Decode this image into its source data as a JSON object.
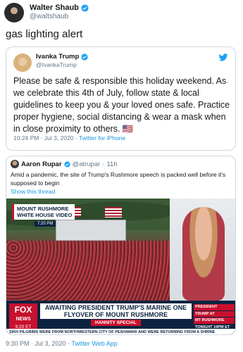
{
  "author": {
    "display_name": "Walter Shaub",
    "handle": "@waltshaub"
  },
  "tweet": {
    "text": "gas lighting alert",
    "timestamp": "9:30 PM · Jul 3, 2020",
    "source": "Twitter Web App"
  },
  "quoted_tweet": {
    "display_name": "Ivanka Trump",
    "handle": "@IvankaTrump",
    "text": "Please be safe & responsible this holiday weekend. As we celebrate this 4th of July, follow state & local guidelines to keep you & your loved ones safe. Practice proper hygiene, social distancing & wear a mask when in close proximity to others. 🇺🇸",
    "timestamp": "10:24 PM · Jul 3, 2020",
    "source": "Twitter for iPhone"
  },
  "nested_quote": {
    "display_name": "Aaron Rupar",
    "handle": "@atrupar",
    "age": "11h",
    "text": "Amid a pandemic, the site of Trump's Rushmore speech is packed well before it's supposed to begin",
    "show_thread": "Show this thread",
    "video": {
      "chyron_line1": "MOUNT RUSHMORE",
      "chyron_line2": "WHITE HOUSE VIDEO",
      "chyron_time": "7:20 PM",
      "network": "FOX",
      "network_sub": "NEWS",
      "clock": "9:20 ET",
      "headline": "AWAITING PRESIDENT TRUMP'S MARINE ONE FLYOVER OF MOUNT RUSHMORE",
      "show_name": "HANNITY SPECIAL",
      "promo_line1": "PRESIDENT",
      "promo_line2": "TRUMP AT",
      "promo_line3": "MT RUSHMORE",
      "promo_line4": "TONIGHT 10PM ET",
      "ticker": "SIKH PILGRIMS WERE FROM NORTHWESTERN CITY OF PESHAWAR AND WERE RETURNING FROM A SHRINE"
    }
  },
  "colors": {
    "link": "#1b95e0",
    "verified": "#1da1f2",
    "muted": "#657786"
  }
}
